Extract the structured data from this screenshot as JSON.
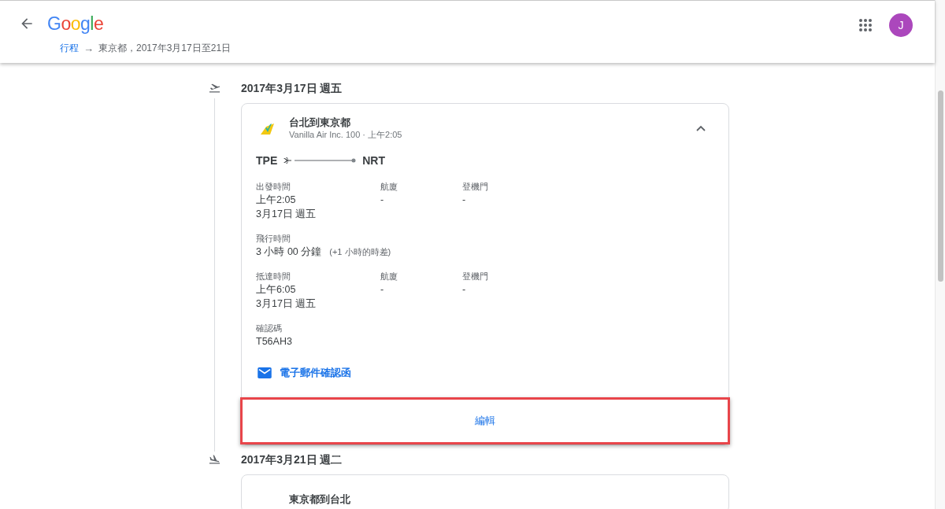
{
  "header": {
    "logo": "Google",
    "breadcrumb": {
      "link": "行程",
      "arrow": "→",
      "current": "東京都，2017年3月17日至21日"
    },
    "avatar": "J"
  },
  "days": [
    {
      "kind": "takeoff",
      "date": "2017年3月17日 週五",
      "flights": [
        {
          "title": "台北到東京都",
          "subtitle": "Vanilla Air Inc. 100 · 上午2:05",
          "expanded": true,
          "origin": "TPE",
          "destination": "NRT",
          "sections": [
            {
              "columns": [
                {
                  "label": "出發時間",
                  "lines": [
                    "上午2:05",
                    "3月17日 週五"
                  ]
                },
                {
                  "label": "航廈",
                  "lines": [
                    "-"
                  ]
                },
                {
                  "label": "登機門",
                  "lines": [
                    "-"
                  ]
                }
              ]
            },
            {
              "columns": [
                {
                  "label": "飛行時間",
                  "lines": [
                    "3 小時 00 分鐘"
                  ],
                  "note": "(+1 小時的時差)"
                }
              ]
            },
            {
              "columns": [
                {
                  "label": "抵達時間",
                  "lines": [
                    "上午6:05",
                    "3月17日 週五"
                  ]
                },
                {
                  "label": "航廈",
                  "lines": [
                    "-"
                  ]
                },
                {
                  "label": "登機門",
                  "lines": [
                    "-"
                  ]
                }
              ]
            },
            {
              "columns": [
                {
                  "label": "確認碼",
                  "lines": [
                    "T56AH3"
                  ]
                }
              ]
            }
          ],
          "email_link": "電子郵件確認函",
          "edit_button": {
            "label": "編輯",
            "highlighted": true
          }
        }
      ]
    },
    {
      "kind": "landing",
      "date": "2017年3月21日 週二",
      "flights": [
        {
          "title": "東京都到台北"
        }
      ]
    }
  ]
}
